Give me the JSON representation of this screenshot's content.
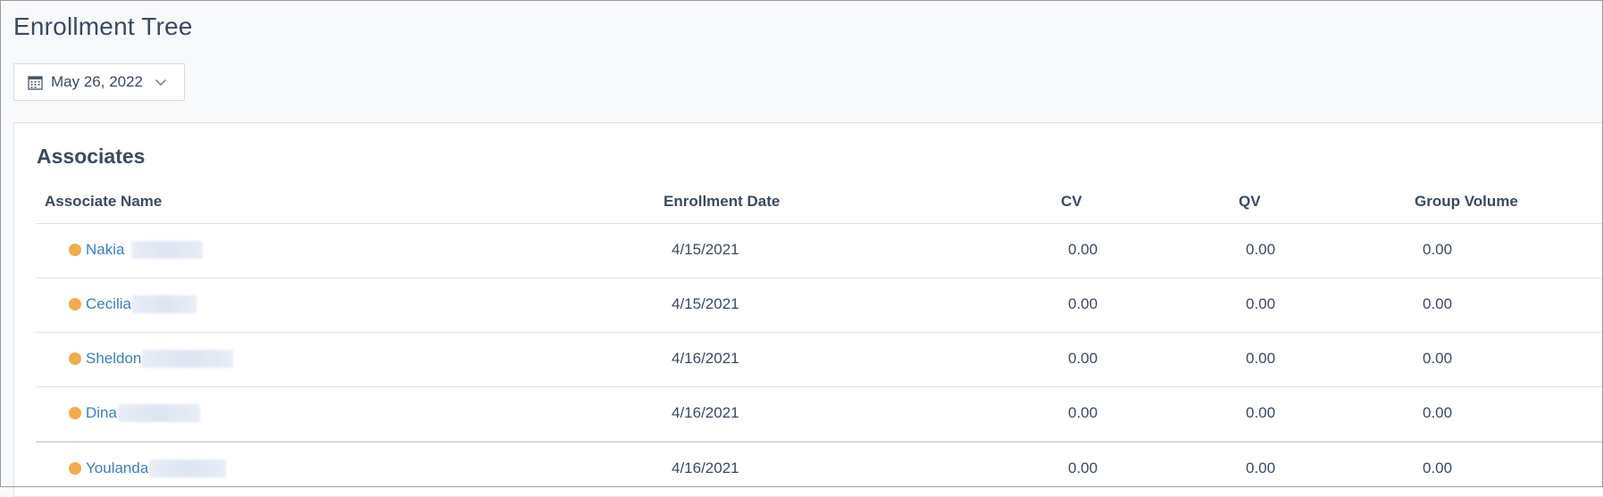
{
  "page": {
    "title": "Enrollment Tree"
  },
  "date_picker": {
    "value": "May 26, 2022",
    "icon": "calendar-icon",
    "dropdown_icon": "chevron-down-icon"
  },
  "section": {
    "title": "Associates"
  },
  "table": {
    "columns": [
      "Associate Name",
      "Enrollment Date",
      "CV",
      "QV",
      "Group Volume"
    ],
    "rows": [
      {
        "name": "Nakia",
        "enrollment_date": "4/15/2021",
        "cv": "0.00",
        "qv": "0.00",
        "group_volume": "0.00"
      },
      {
        "name": "Cecilia",
        "enrollment_date": "4/15/2021",
        "cv": "0.00",
        "qv": "0.00",
        "group_volume": "0.00"
      },
      {
        "name": "Sheldon",
        "enrollment_date": "4/16/2021",
        "cv": "0.00",
        "qv": "0.00",
        "group_volume": "0.00"
      },
      {
        "name": "Dina",
        "enrollment_date": "4/16/2021",
        "cv": "0.00",
        "qv": "0.00",
        "group_volume": "0.00"
      },
      {
        "name": "Youlanda",
        "enrollment_date": "4/16/2021",
        "cv": "0.00",
        "qv": "0.00",
        "group_volume": "0.00"
      }
    ]
  },
  "colors": {
    "status_dot": "#f0ad4e",
    "link": "#3a7fc1",
    "text": "#3b4a5f"
  }
}
